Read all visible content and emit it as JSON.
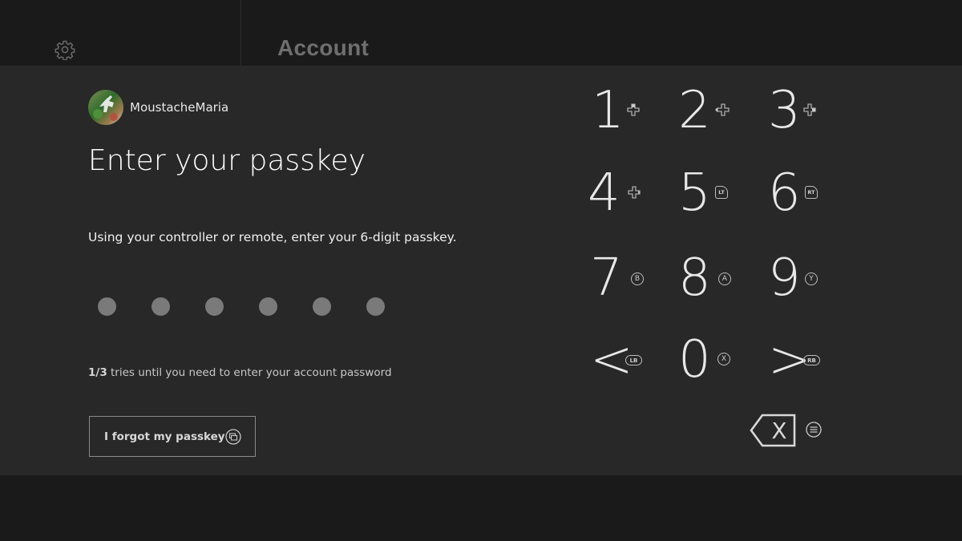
{
  "header": {
    "title": "Account",
    "settings_icon": "gear-icon"
  },
  "user": {
    "name": "MoustacheMaria",
    "avatar_icon": "user-avatar"
  },
  "passkey": {
    "heading": "Enter your passkey",
    "instructions": "Using your controller or remote, enter your 6-digit passkey.",
    "digits_entered": 0,
    "digits_total": 6,
    "tries_count": "1/3",
    "tries_text": " tries until you need to enter your account password",
    "forgot_label": "I forgot my passkey",
    "forgot_icon": "view-button-icon"
  },
  "keypad": {
    "keys": [
      {
        "label": "1",
        "hint": "dpad-up-icon"
      },
      {
        "label": "2",
        "hint": "dpad-left-icon"
      },
      {
        "label": "3",
        "hint": "dpad-right-icon"
      },
      {
        "label": "4",
        "hint": "dpad-down-icon"
      },
      {
        "label": "5",
        "hint": "LT"
      },
      {
        "label": "6",
        "hint": "RT"
      },
      {
        "label": "7",
        "hint": "B"
      },
      {
        "label": "8",
        "hint": "A"
      },
      {
        "label": "9",
        "hint": "Y"
      },
      {
        "label": "<",
        "hint": "LB"
      },
      {
        "label": "0",
        "hint": "X"
      },
      {
        "label": ">",
        "hint": "RB"
      }
    ],
    "backspace_label": "X",
    "backspace_icon": "backspace-icon",
    "menu_icon": "menu-button-icon"
  },
  "colors": {
    "panel": "#282828",
    "background": "#1a1a1a",
    "dot": "#7a7a7a",
    "title": "#6f6f6f"
  }
}
